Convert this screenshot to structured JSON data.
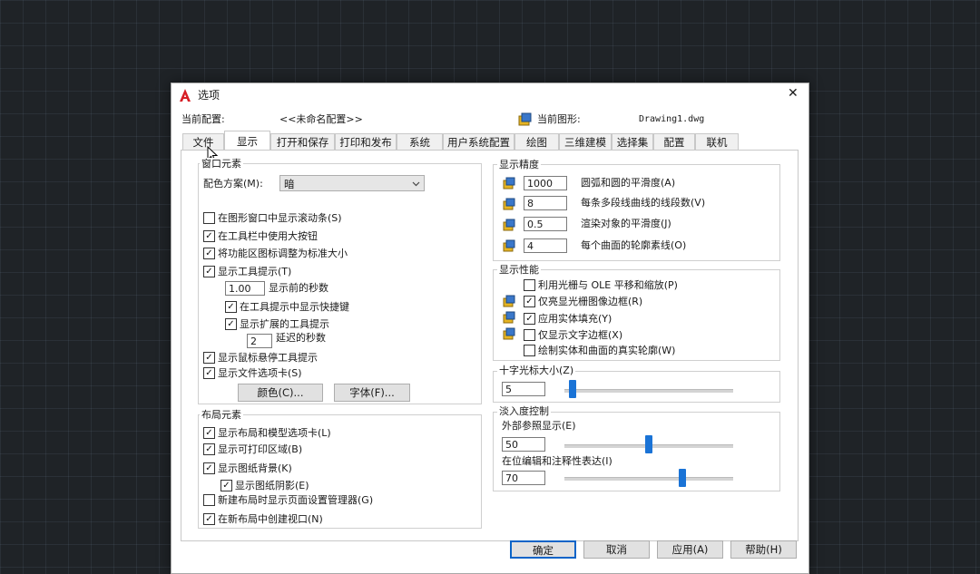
{
  "window": {
    "title": "选项",
    "close_symbol": "✕"
  },
  "header": {
    "current_profile_label": "当前配置:",
    "current_profile_value": "<<未命名配置>>",
    "current_drawing_label": "当前图形:",
    "current_drawing_value": "Drawing1.dwg"
  },
  "tabs": [
    "文件",
    "显示",
    "打开和保存",
    "打印和发布",
    "系统",
    "用户系统配置",
    "绘图",
    "三维建模",
    "选择集",
    "配置",
    "联机"
  ],
  "active_tab": "显示",
  "window_elements": {
    "title": "窗口元素",
    "color_scheme_label": "配色方案(M):",
    "color_scheme_value": "暗",
    "checkboxes": [
      {
        "label": "在图形窗口中显示滚动条(S)",
        "checked": false
      },
      {
        "label": "在工具栏中使用大按钮",
        "checked": true
      },
      {
        "label": "将功能区图标调整为标准大小",
        "checked": true
      },
      {
        "label": "显示工具提示(T)",
        "checked": true
      }
    ],
    "tooltip_delay_value": "1.00",
    "tooltip_delay_label": "显示前的秒数",
    "show_shortcut_label": "在工具提示中显示快捷键",
    "show_shortcut_checked": true,
    "extended_tooltips_label": "显示扩展的工具提示",
    "extended_tooltips_checked": true,
    "extended_delay_value": "2",
    "extended_delay_label": "延迟的秒数",
    "rollover_label": "显示鼠标悬停工具提示",
    "rollover_checked": true,
    "file_tabs_label": "显示文件选项卡(S)",
    "file_tabs_checked": true,
    "colors_button": "颜色(C)...",
    "fonts_button": "字体(F)..."
  },
  "layout_elements": {
    "title": "布局元素",
    "checkboxes": [
      {
        "label": "显示布局和模型选项卡(L)",
        "checked": true
      },
      {
        "label": "显示可打印区域(B)",
        "checked": true
      },
      {
        "label": "显示图纸背景(K)",
        "checked": true
      }
    ],
    "paper_shadow_label": "显示图纸阴影(E)",
    "paper_shadow_checked": true,
    "more_checkboxes": [
      {
        "label": "新建布局时显示页面设置管理器(G)",
        "checked": false
      },
      {
        "label": "在新布局中创建视口(N)",
        "checked": true
      }
    ]
  },
  "display_resolution": {
    "title": "显示精度",
    "rows": [
      {
        "value": "1000",
        "label": "圆弧和圆的平滑度(A)"
      },
      {
        "value": "8",
        "label": "每条多段线曲线的线段数(V)"
      },
      {
        "value": "0.5",
        "label": "渲染对象的平滑度(J)"
      },
      {
        "value": "4",
        "label": "每个曲面的轮廓素线(O)"
      }
    ]
  },
  "display_performance": {
    "title": "显示性能",
    "checkboxes": [
      {
        "label": "利用光栅与 OLE 平移和缩放(P)",
        "checked": false
      },
      {
        "label": "仅亮显光栅图像边框(R)",
        "checked": true
      },
      {
        "label": "应用实体填充(Y)",
        "checked": true
      },
      {
        "label": "仅显示文字边框(X)",
        "checked": false
      },
      {
        "label": "绘制实体和曲面的真实轮廓(W)",
        "checked": false
      }
    ]
  },
  "crosshair": {
    "title": "十字光标大小(Z)",
    "value": "5",
    "level_percent": 5
  },
  "fade": {
    "title": "淡入度控制",
    "xref_label": "外部参照显示(E)",
    "xref_value": "50",
    "xref_level_percent": 50,
    "inplace_label": "在位编辑和注释性表达(I)",
    "inplace_value": "70",
    "inplace_level_percent": 70
  },
  "buttons": {
    "ok": "确定",
    "cancel": "取消",
    "apply": "应用(A)",
    "help": "帮助(H)"
  },
  "check_glyph": "✓"
}
